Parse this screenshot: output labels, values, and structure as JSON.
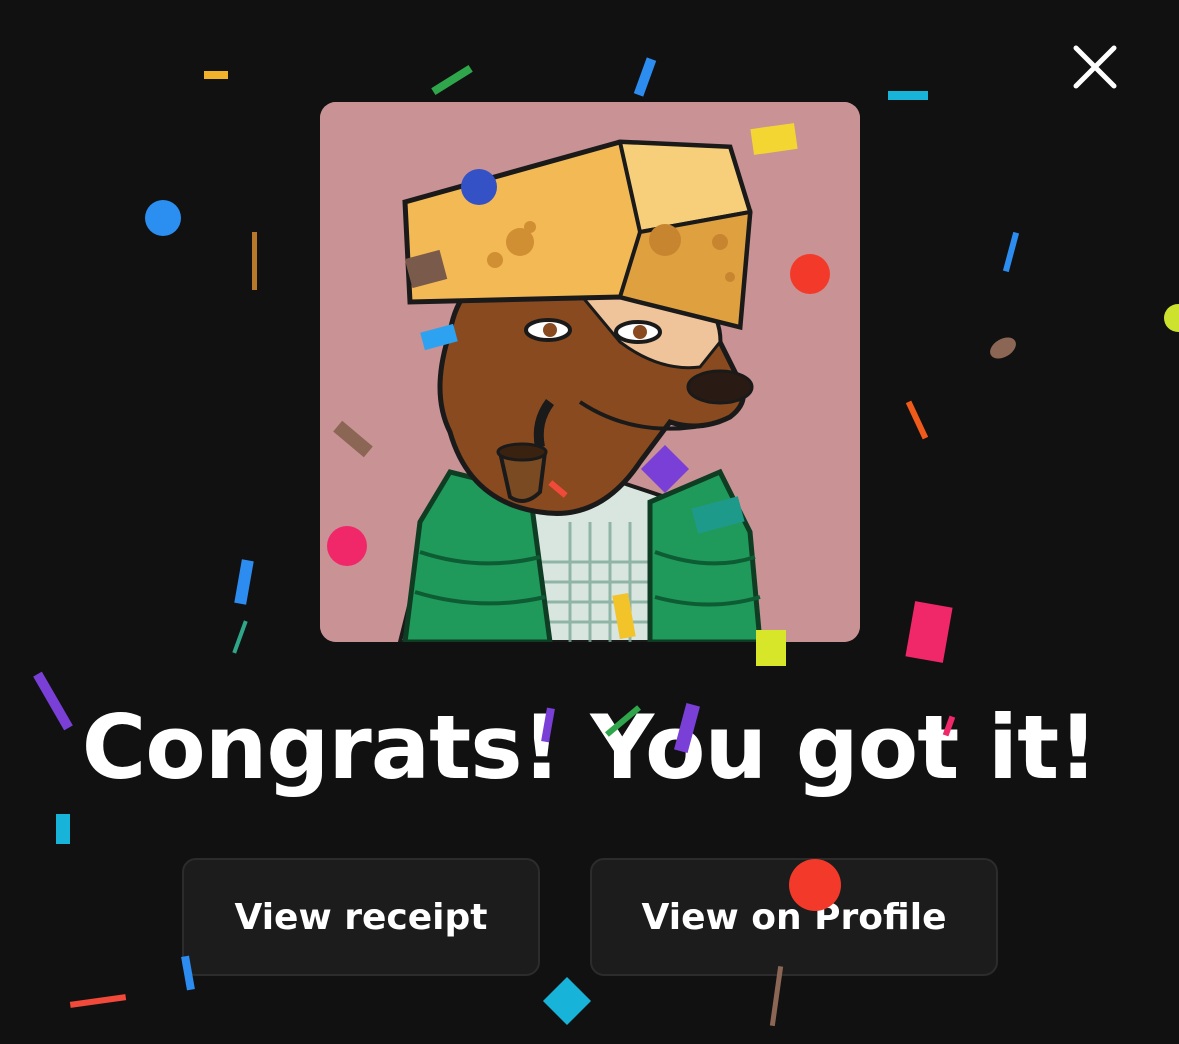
{
  "dialog": {
    "close_icon": "close-icon",
    "headline": "Congrats! You got it!",
    "art_alt": "NFT artwork: cartoon dog wearing a cheese hat, green puffer vest and a pipe"
  },
  "actions": {
    "view_receipt_label": "View receipt",
    "view_on_profile_label": "View on Profile"
  },
  "colors": {
    "background": "#111111",
    "button_bg": "#1c1c1c",
    "button_border": "#2c2c2c",
    "art_bg": "#c99294",
    "text": "#ffffff"
  }
}
